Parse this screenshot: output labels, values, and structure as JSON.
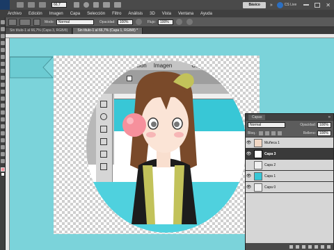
{
  "app": {
    "workspace_label": "Básico",
    "cs_live_label": "CS Live",
    "zoom_value": "66,7"
  },
  "menu": [
    "Archivo",
    "Edición",
    "Imagen",
    "Capa",
    "Selección",
    "Filtro",
    "Análisis",
    "3D",
    "Vista",
    "Ventana",
    "Ayuda"
  ],
  "options_bar": {
    "mode_label": "Modo:",
    "mode_value": "Normal",
    "opacity_label": "Opacidad:",
    "opacity_value": "100%",
    "flow_label": "Flujo:",
    "flow_value": "100%"
  },
  "tabs": [
    {
      "label": "Sin título-1 al 66,7% (Capa 3, RGB/8)",
      "active": false
    },
    {
      "label": "Sin título-1 al 66,7% (Capa 1, RGB/8) *",
      "active": true
    }
  ],
  "screenshot_menu": [
    "ción",
    "Imagen",
    "Capa"
  ],
  "layers_panel": {
    "tab_label": "Capas",
    "blend_mode": "Normal",
    "opacity_label": "Opacidad:",
    "opacity_value": "100%",
    "lock_label": "Bloq.:",
    "fill_label": "Relleno:",
    "fill_value": "100%",
    "layers": [
      {
        "name": "Muñeca 1",
        "visible": true,
        "selected": false
      },
      {
        "name": "Capa 3",
        "visible": true,
        "selected": true
      },
      {
        "name": "Capa 2",
        "visible": false,
        "selected": false
      },
      {
        "name": "Capa 1",
        "visible": true,
        "selected": false
      },
      {
        "name": "Capa 0",
        "visible": true,
        "selected": false
      }
    ]
  },
  "colors": {
    "canvas_bg": "#7bd3da",
    "cyan_accent": "#38c7d6",
    "hair": "#7a4a2a",
    "bubble": "#f6909c",
    "scarf": "#c2c25a"
  }
}
